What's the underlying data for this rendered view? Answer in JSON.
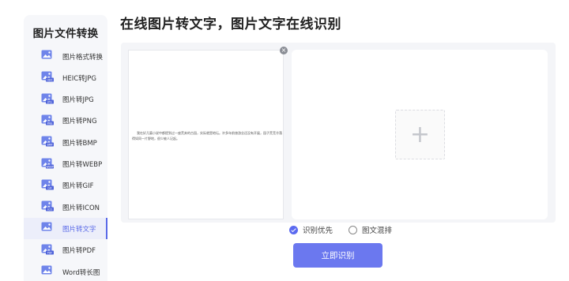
{
  "page": {
    "title": "在线图片转文字，图片文字在线识别"
  },
  "sidebar": {
    "title": "图片文件转换",
    "active_index": 8,
    "items": [
      {
        "label": "图片格式转换",
        "icon": "image-icon",
        "badge": ""
      },
      {
        "label": "HEIC转JPG",
        "icon": "heic-file-icon",
        "badge": "HEIC"
      },
      {
        "label": "图片转JPG",
        "icon": "jpg-file-icon",
        "badge": "JPG"
      },
      {
        "label": "图片转PNG",
        "icon": "png-file-icon",
        "badge": "PNG"
      },
      {
        "label": "图片转BMP",
        "icon": "bmp-file-icon",
        "badge": "BMP"
      },
      {
        "label": "图片转WEBP",
        "icon": "webp-file-icon",
        "badge": "WEBP"
      },
      {
        "label": "图片转GIF",
        "icon": "gif-file-icon",
        "badge": "GIF"
      },
      {
        "label": "图片转ICON",
        "icon": "icon-file-icon",
        "badge": "ICO"
      },
      {
        "label": "图片转文字",
        "icon": "text-file-icon",
        "badge": ""
      },
      {
        "label": "图片转PDF",
        "icon": "pdf-file-icon",
        "badge": "PDF"
      },
      {
        "label": "Word转长图",
        "icon": "word-file-icon",
        "badge": ""
      }
    ]
  },
  "document": {
    "text": "我在好几篇小说中都提到过一座荒弃的古园，实际就是地坛。许多年前旅游业还没有开展，园子荒芜冷落得如同一片野地，很少被人记起。"
  },
  "uploader": {
    "add_symbol": "+"
  },
  "options": [
    {
      "label": "识别优先",
      "selected": true
    },
    {
      "label": "图文混排",
      "selected": false
    }
  ],
  "submit": {
    "label": "立即识别"
  },
  "colors": {
    "accent": "#5a6ae8",
    "button": "#6b78ef",
    "icon": "#6f84ea"
  }
}
